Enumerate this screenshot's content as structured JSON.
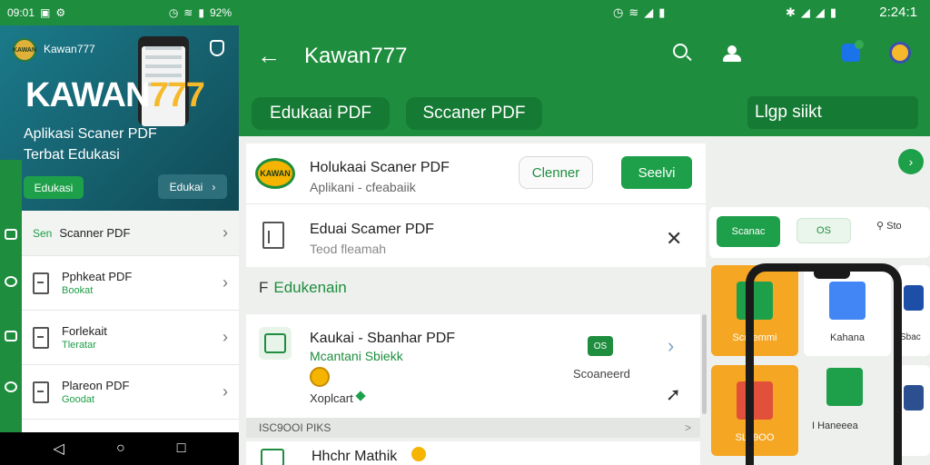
{
  "left": {
    "status_time": "09:01",
    "status_battery": "92%",
    "brand_small": "Kawan777",
    "big_a": "KAWAN",
    "big_b": "777",
    "logo_text": "KAWAN",
    "subtitle": "Aplikasi Scaner PDF Terbat Edukasi",
    "btn_primary": "Edukasi",
    "btn_secondary": "Edukai",
    "list": [
      {
        "prefix": "Sen",
        "title": "Scanner PDF",
        "sub": ""
      },
      {
        "title": "Pphkeat PDF",
        "sub": "Bookat"
      },
      {
        "title": "Forlekait",
        "sub": "Tleratar"
      },
      {
        "title": "Plareon PDF",
        "sub": "Goodat"
      }
    ]
  },
  "right": {
    "status_time": "2:24:1",
    "app_title": "Kawan777",
    "tabs": [
      "Edukaai PDF",
      "Sccaner PDF"
    ],
    "search_field": "Llgp siikt",
    "card1": {
      "logo_text": "KAWAN",
      "title": "Holukaai Scaner PDF",
      "sub": "Aplikani - cfeabaiik",
      "clear_btn": "Clenner",
      "scan_btn": "Seelvi",
      "row2_title": "Eduai Scamer PDF",
      "row2_sub": "Teod fleamah"
    },
    "section": {
      "prefix": "F",
      "title": "Edukenain"
    },
    "card2": {
      "title": "Kaukai - Sbanhar PDF",
      "sub": "Mcantani Sbiekk",
      "footer": "Xoplcart",
      "badge": "OS",
      "badge_label": "Scoaneerd"
    },
    "section2": {
      "label": "ISC9OOI PIKS",
      "chevron": ">"
    },
    "card3_title": "Hhchr Mathik",
    "chips": [
      "Scanac",
      "OS",
      "Sto"
    ],
    "tiles": [
      {
        "label": "Scmemmi"
      },
      {
        "label": "Kahana"
      },
      {
        "label": "Sbac"
      },
      {
        "label": "SL..9OO"
      },
      {
        "label": "I Haneeea"
      }
    ]
  },
  "colors": {
    "primary_green": "#1e8e3e",
    "accent_orange": "#f5a623",
    "teal": "#16606e"
  }
}
